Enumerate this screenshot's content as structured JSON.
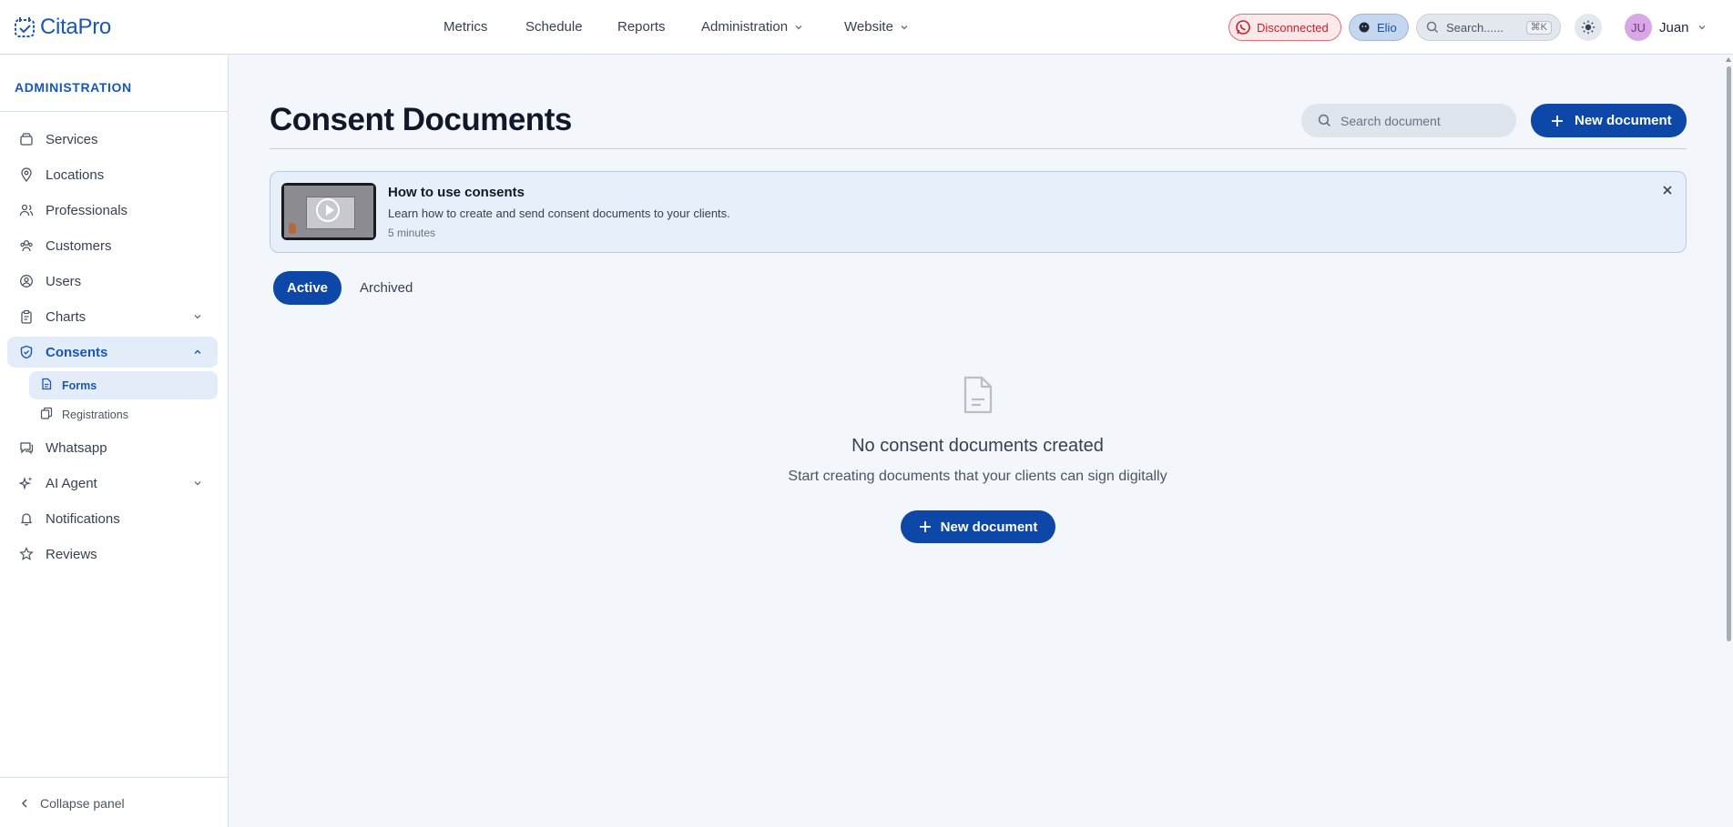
{
  "app": {
    "logo_text": "CitaPro"
  },
  "topnav": {
    "items": [
      {
        "label": "Metrics"
      },
      {
        "label": "Schedule"
      },
      {
        "label": "Reports"
      },
      {
        "label": "Administration"
      },
      {
        "label": "Website"
      }
    ]
  },
  "header": {
    "whatsapp_status": "Disconnected",
    "agent_name": "Elio",
    "search_placeholder": "Search......",
    "search_shortcut": "⌘K",
    "user_initials": "JU",
    "user_name": "Juan"
  },
  "sidebar": {
    "heading": "ADMINISTRATION",
    "items": [
      {
        "label": "Services",
        "icon": "box-icon"
      },
      {
        "label": "Locations",
        "icon": "map-pin-icon"
      },
      {
        "label": "Professionals",
        "icon": "users-icon"
      },
      {
        "label": "Customers",
        "icon": "customers-icon"
      },
      {
        "label": "Users",
        "icon": "user-circle-icon"
      },
      {
        "label": "Charts",
        "icon": "clipboard-icon"
      },
      {
        "label": "Consents",
        "icon": "shield-check-icon"
      },
      {
        "label": "Whatsapp",
        "icon": "chat-icon"
      },
      {
        "label": "AI Agent",
        "icon": "sparkles-icon"
      },
      {
        "label": "Notifications",
        "icon": "bell-icon"
      },
      {
        "label": "Reviews",
        "icon": "star-icon"
      }
    ],
    "consents_sub": [
      {
        "label": "Forms",
        "icon": "document-icon"
      },
      {
        "label": "Registrations",
        "icon": "copy-icon"
      }
    ],
    "collapse_label": "Collapse panel"
  },
  "main": {
    "title": "Consent Documents",
    "search_placeholder": "Search document",
    "new_button": "New document",
    "banner": {
      "title": "How to use consents",
      "description": "Learn how to create and send consent documents to your clients.",
      "duration": "5 minutes"
    },
    "tabs": {
      "active": "Active",
      "archived": "Archived"
    },
    "empty": {
      "title": "No consent documents created",
      "subtitle": "Start creating documents that your clients can sign digitally",
      "button": "New document"
    }
  },
  "colors": {
    "accent": "#0d47a8",
    "brand": "#1a56b8",
    "danger": "#c8202e",
    "background": "#f3f6fa"
  }
}
